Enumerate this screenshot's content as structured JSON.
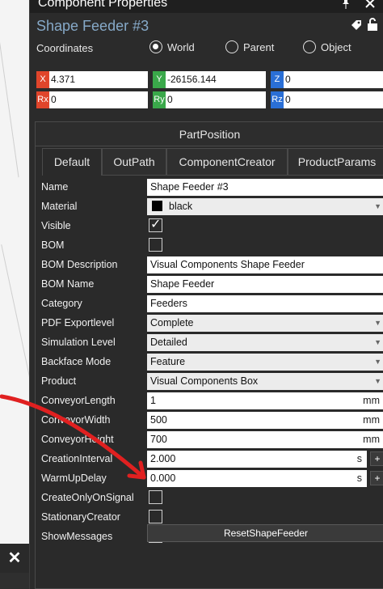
{
  "window": {
    "title": "Component Properties"
  },
  "component": {
    "name": "Shape Feeder #3"
  },
  "coordinates": {
    "label": "Coordinates",
    "options": [
      "World",
      "Parent",
      "Object"
    ],
    "selected": "World"
  },
  "transform": {
    "x": {
      "label": "X",
      "value": "4.371",
      "color": "#e0452b"
    },
    "y": {
      "label": "Y",
      "value": "-26156.144",
      "color": "#3aa84a"
    },
    "z": {
      "label": "Z",
      "value": "0",
      "color": "#2a6fd6"
    },
    "rx": {
      "label": "Rx",
      "value": "0",
      "color": "#e0452b"
    },
    "ry": {
      "label": "Ry",
      "value": "0",
      "color": "#3aa84a"
    },
    "rz": {
      "label": "Rz",
      "value": "0",
      "color": "#2a6fd6"
    }
  },
  "section": {
    "title": "PartPosition"
  },
  "tabs": [
    "Default",
    "OutPath",
    "ComponentCreator",
    "ProductParams"
  ],
  "active_tab": "Default",
  "properties": {
    "name": {
      "label": "Name",
      "value": "Shape Feeder #3"
    },
    "material": {
      "label": "Material",
      "value": "black"
    },
    "visible": {
      "label": "Visible",
      "checked": true
    },
    "bom": {
      "label": "BOM",
      "checked": false
    },
    "bom_description": {
      "label": "BOM Description",
      "value": "Visual Components Shape Feeder"
    },
    "bom_name": {
      "label": "BOM Name",
      "value": "Shape Feeder"
    },
    "category": {
      "label": "Category",
      "value": "Feeders"
    },
    "pdf_exportlevel": {
      "label": "PDF Exportlevel",
      "value": "Complete"
    },
    "simulation_level": {
      "label": "Simulation Level",
      "value": "Detailed"
    },
    "backface_mode": {
      "label": "Backface Mode",
      "value": "Feature"
    },
    "product": {
      "label": "Product",
      "value": "Visual Components Box"
    },
    "conveyor_length": {
      "label": "ConveyorLength",
      "value": "1",
      "unit": "mm"
    },
    "conveyor_width": {
      "label": "ConveyorWidth",
      "value": "500",
      "unit": "mm"
    },
    "conveyor_height": {
      "label": "ConveyorHeight",
      "value": "700",
      "unit": "mm"
    },
    "creation_interval": {
      "label": "CreationInterval",
      "value": "2.000",
      "unit": "s"
    },
    "warmup_delay": {
      "label": "WarmUpDelay",
      "value": "0.000",
      "unit": "s"
    },
    "create_only_on_signal": {
      "label": "CreateOnlyOnSignal",
      "checked": false
    },
    "stationary_creator": {
      "label": "StationaryCreator",
      "checked": false
    },
    "show_messages": {
      "label": "ShowMessages",
      "checked": false
    }
  },
  "reset_button": {
    "label": "ResetShapeFeeder"
  },
  "plus_glyph": "+",
  "left_close_glyph": "✕",
  "icons": [
    "pin-icon",
    "close-icon",
    "tag-icon",
    "unlock-icon",
    "dropdown-arrow-icon",
    "checkmark-icon"
  ],
  "annotation_color": "#e02020"
}
